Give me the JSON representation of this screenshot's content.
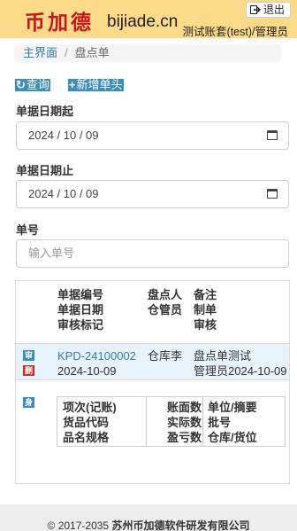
{
  "header": {
    "logo_text": "币加德",
    "domain": "bijiade.cn",
    "logout_label": "退出",
    "user_info": "测试账套(test)/管理员"
  },
  "breadcrumb": {
    "home": "主界面",
    "separator": "/",
    "current": "盘点单"
  },
  "toolbar": {
    "query_label": "查询",
    "add_label": "新增单头"
  },
  "filters": {
    "date_from_label": "单据日期起",
    "date_from_value": "2024 / 10 / 09",
    "date_to_label": "单据日期止",
    "date_to_value": "2024 / 10 / 09",
    "doc_no_label": "单号",
    "doc_no_placeholder": "输入单号"
  },
  "table_header": {
    "col1": [
      "单据编号",
      "单据日期",
      "审核标记"
    ],
    "col2": [
      "盘点人",
      "仓管员"
    ],
    "col3": [
      "备注",
      "制单",
      "审核"
    ]
  },
  "row": {
    "doc_no": "KPD-24100002",
    "date": "2024-10-09",
    "counter": "仓库李",
    "remark": "盘点单测试",
    "creator": "管理员2024-10-09",
    "audit_icon": "审",
    "delete_icon": "删",
    "add_detail_icon": "身"
  },
  "detail_header": {
    "col1": [
      "项次(记账)",
      "货品代码",
      "品名规格"
    ],
    "col2": [
      "账面数",
      "实际数",
      "盈亏数"
    ],
    "col3": [
      "单位/摘要",
      "批号",
      "仓库/货位"
    ]
  },
  "footer": {
    "copyright": "© 2017-2035 ",
    "company": "苏州币加德软件研发有限公司"
  }
}
